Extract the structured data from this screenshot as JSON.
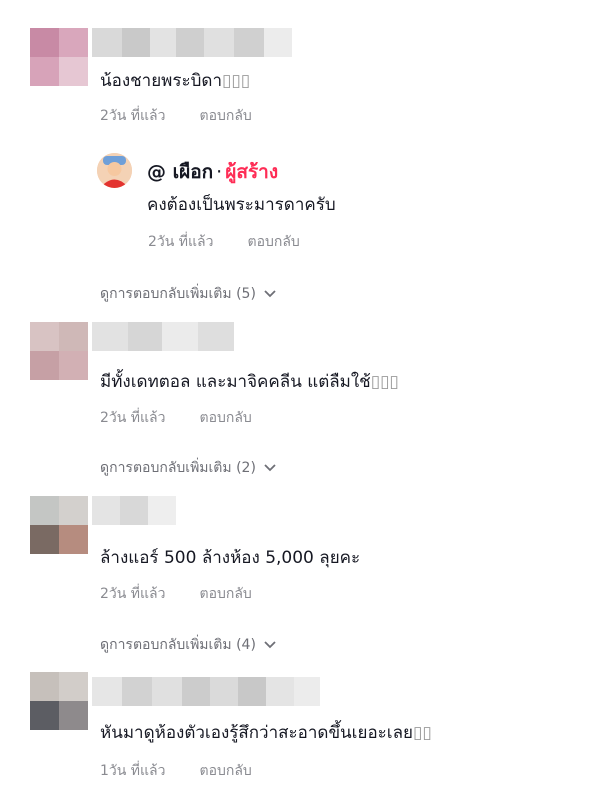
{
  "comments": [
    {
      "text": "น้องชายพระบิดา",
      "emoji": "▯▯▯",
      "time": "2วัน ที่แล้ว",
      "reply_label": "ตอบกลับ",
      "creator_reply": {
        "name": "@ เผือก",
        "separator": "·",
        "badge": "ผู้สร้าง",
        "text": "คงต้องเป็นพระมารดาครับ",
        "time": "2วัน ที่แล้ว",
        "reply_label": "ตอบกลับ"
      },
      "more_replies": "ดูการตอบกลับเพิ่มเติม (5)"
    },
    {
      "text": "มีทั้งเดทตอล และมาจิคคลีน แต่ลืมใช้",
      "emoji": "▯▯▯",
      "time": "2วัน ที่แล้ว",
      "reply_label": "ตอบกลับ",
      "more_replies": "ดูการตอบกลับเพิ่มเติม (2)"
    },
    {
      "text": "ล้างแอร์ 500 ล้างห้อง 5,000 ลุยคะ",
      "emoji": "",
      "time": "2วัน ที่แล้ว",
      "reply_label": "ตอบกลับ",
      "more_replies": "ดูการตอบกลับเพิ่มเติม (4)"
    },
    {
      "text": "หันมาดูห้องตัวเองรู้สึกว่าสะอาดขึ้นเยอะเลย",
      "emoji": "▯▯",
      "time": "1วัน ที่แล้ว",
      "reply_label": "ตอบกลับ"
    }
  ],
  "icons": {
    "more": "chevron-down-icon",
    "avatar": "pixelated-avatar"
  },
  "colors": {
    "creator_badge": "#fe2c55",
    "meta": "#8a8b91",
    "text": "#161823"
  }
}
